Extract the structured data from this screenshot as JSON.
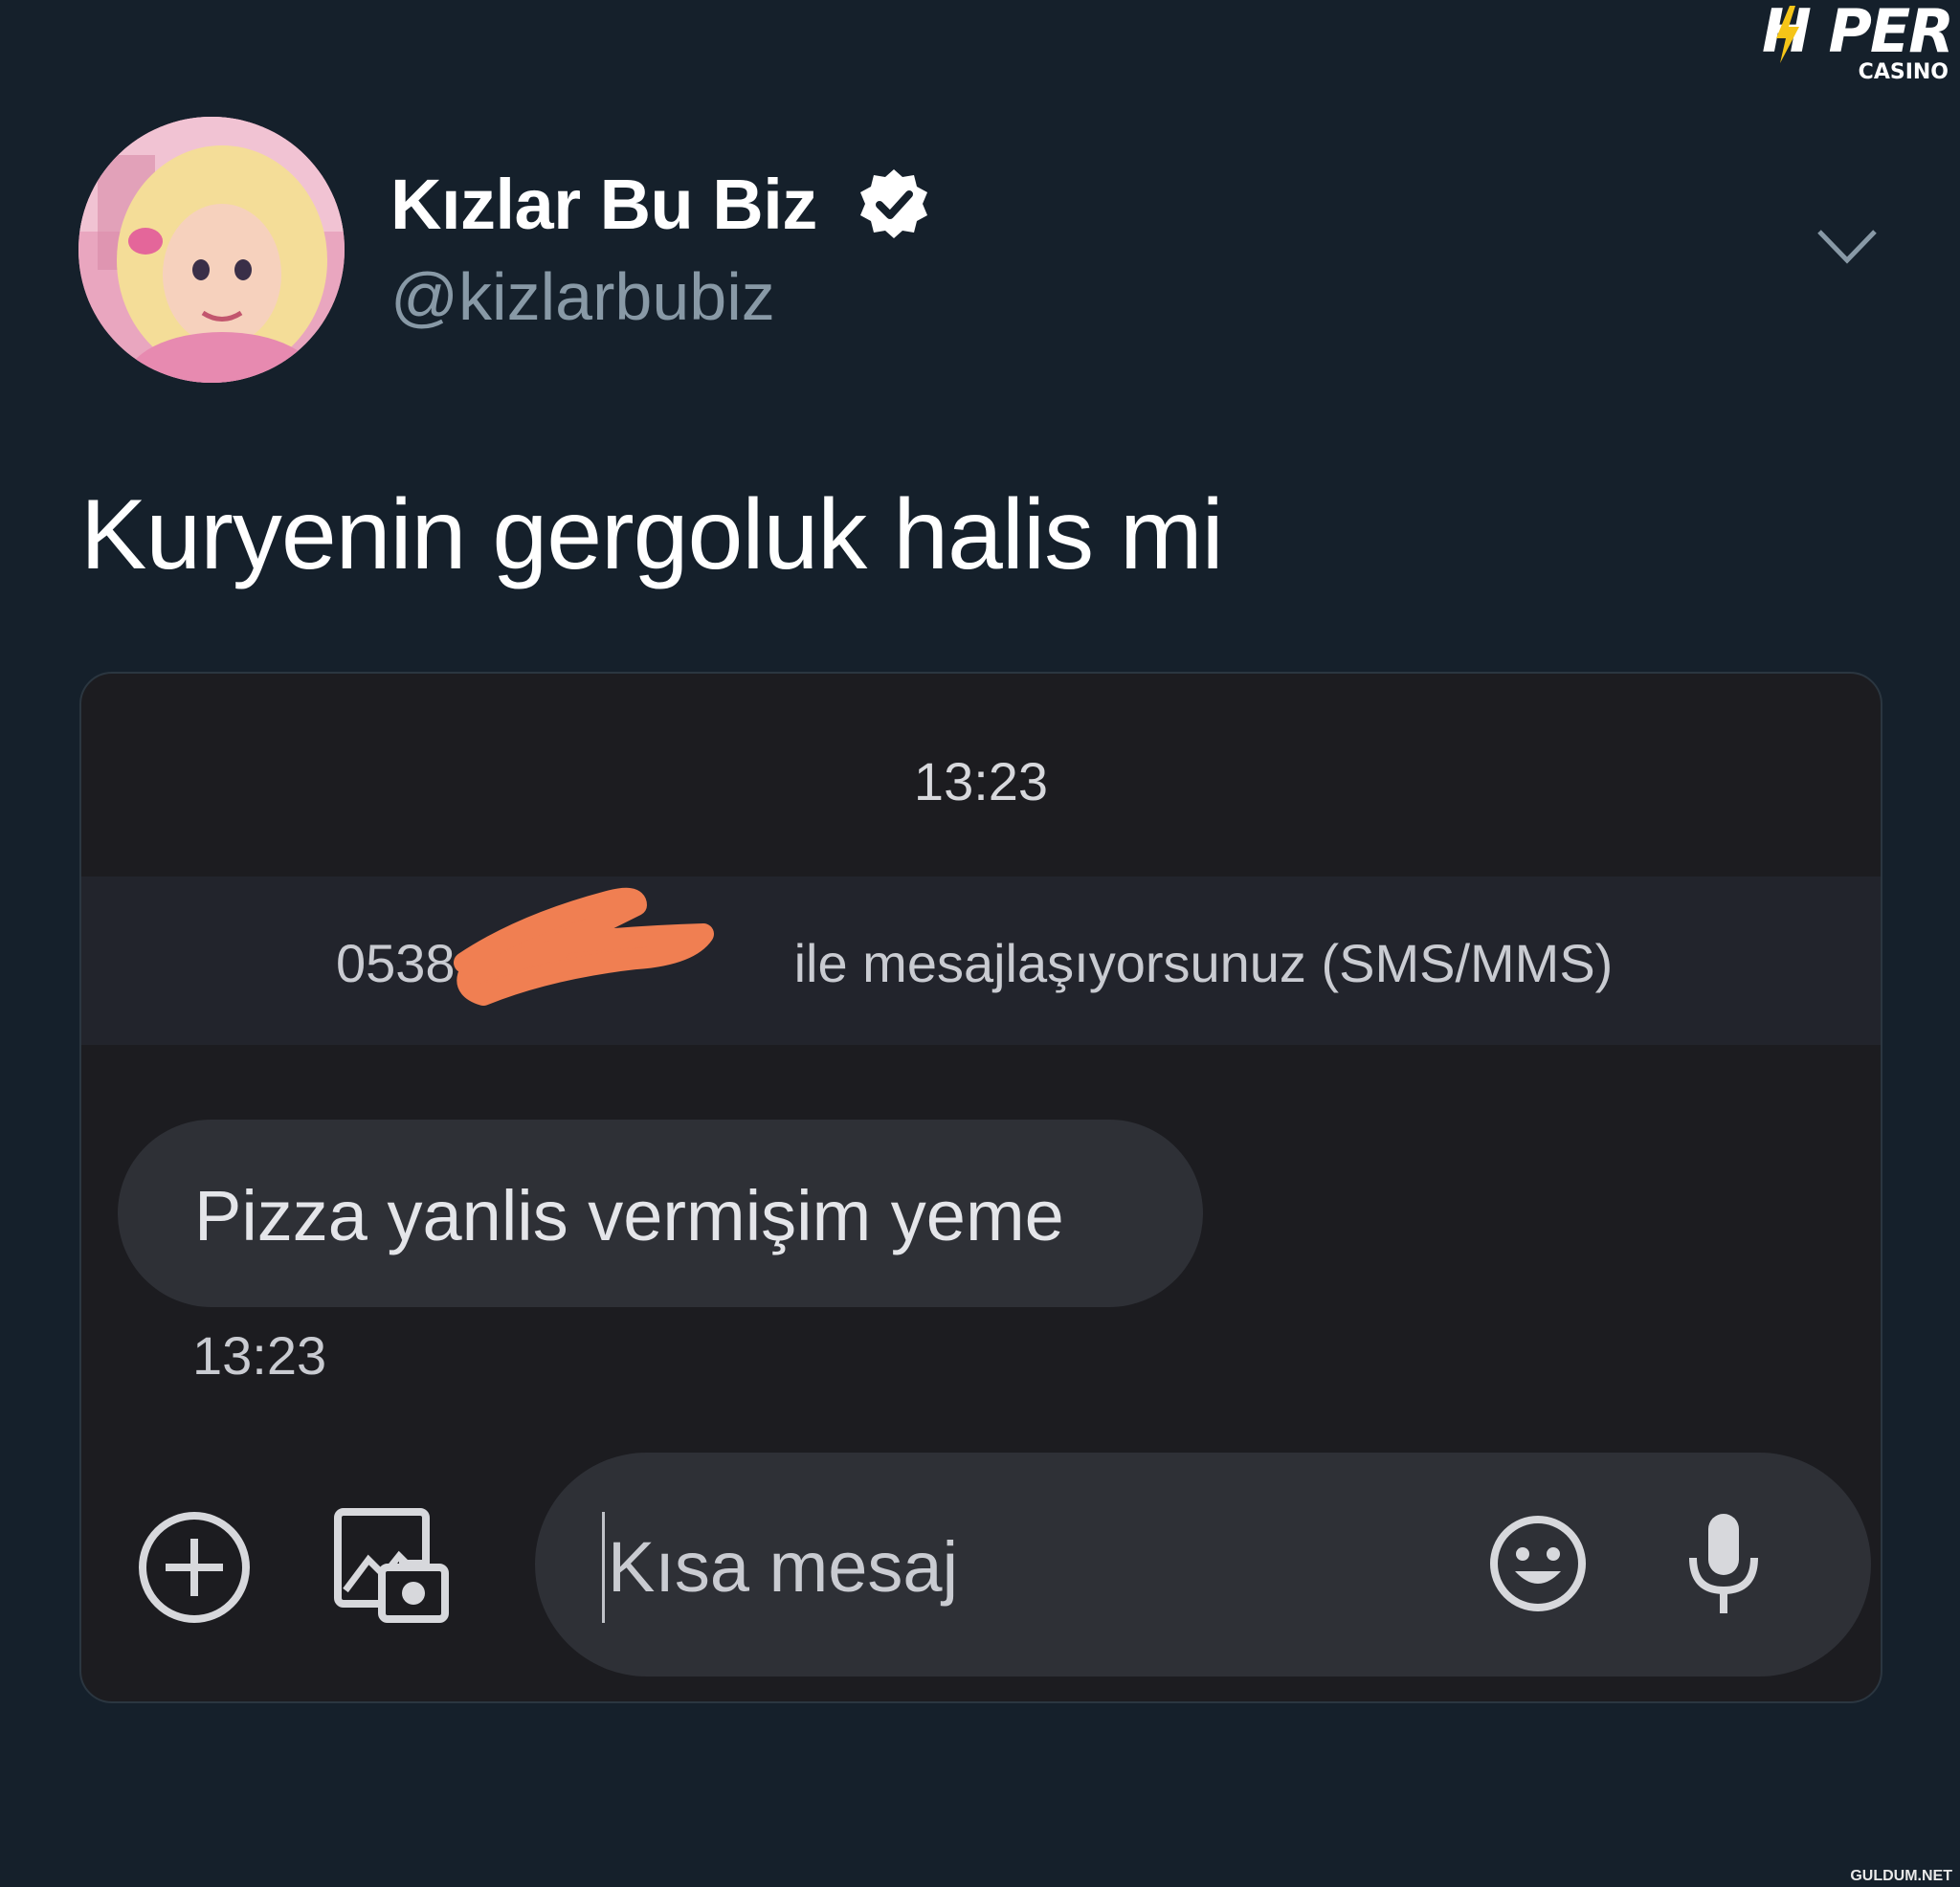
{
  "watermark": {
    "brand": "H PER",
    "sub": "CASINO",
    "footer": "GULDUM.NET"
  },
  "tweet": {
    "author_name": "Kızlar Bu Biz",
    "handle": "@kizlarbubiz",
    "text": "Kuryenin gergoluk halis mi"
  },
  "sms": {
    "header_time": "13:23",
    "info_number": "0538",
    "info_suffix": "ile mesajlaşıyorsunuz (SMS/MMS)",
    "message": "Pizza yanlis vermişim yeme",
    "message_time": "13:23",
    "input_placeholder": "Kısa mesaj"
  },
  "colors": {
    "background": "#15202b",
    "secondary_text": "#8899a6",
    "media_bg": "#1c1c20",
    "bubble_bg": "#2e3036",
    "redaction": "#f07f52"
  },
  "icons": [
    "verified-badge-icon",
    "chevron-down-icon",
    "add-icon",
    "gallery-camera-icon",
    "emoji-icon",
    "microphone-icon"
  ]
}
